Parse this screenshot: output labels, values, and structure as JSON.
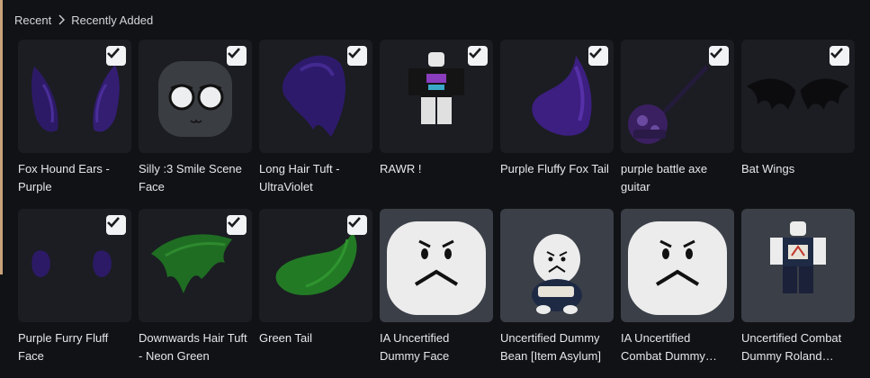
{
  "breadcrumb": {
    "root": "Recent",
    "current": "Recently Added"
  },
  "items": [
    {
      "name": "Fox Hound Ears - Purple",
      "icon": "purple-ears-icon",
      "selected": true
    },
    {
      "name": "Silly :3 Smile Scene Face",
      "icon": "scene-face-icon",
      "selected": true
    },
    {
      "name": "Long Hair Tuft - UltraViolet",
      "icon": "purple-hair-tuft-icon",
      "selected": true
    },
    {
      "name": "RAWR !",
      "icon": "avatar-shirt-icon",
      "selected": true
    },
    {
      "name": "Purple Fluffy Fox Tail",
      "icon": "purple-tail-icon",
      "selected": true
    },
    {
      "name": "purple battle axe guitar",
      "icon": "axe-guitar-icon",
      "selected": true
    },
    {
      "name": "Bat Wings",
      "icon": "bat-wings-icon",
      "selected": true
    },
    {
      "name": "Purple Furry Fluff Face",
      "icon": "purple-fluff-face-icon",
      "selected": true
    },
    {
      "name": "Downwards Hair Tuft - Neon Green",
      "icon": "green-hair-tuft-icon",
      "selected": true
    },
    {
      "name": "Green Tail",
      "icon": "green-tail-icon",
      "selected": true
    },
    {
      "name": "IA Uncertified Dummy Face",
      "icon": "angry-face-icon",
      "selected": false
    },
    {
      "name": "Uncertified Dummy Bean [Item Asylum]",
      "icon": "dummy-bean-icon",
      "selected": false
    },
    {
      "name": "IA Uncertified Combat Dummy Face",
      "icon": "angry-face-icon",
      "selected": false
    },
    {
      "name": "Uncertified Combat Dummy Roland Avatar",
      "icon": "dummy-avatar-icon",
      "selected": false
    }
  ],
  "colors": {
    "background": "#111216",
    "tile": "#1b1d22",
    "tile_light": "#3b3f48",
    "purple": "#3a1f7a",
    "green": "#1f6f1f"
  }
}
